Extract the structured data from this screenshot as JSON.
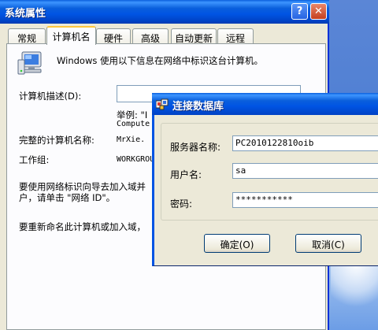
{
  "main_window": {
    "title": "系统属性",
    "help_glyph": "?",
    "close_glyph": "✕",
    "tabs": [
      {
        "label": "常规"
      },
      {
        "label": "计算机名"
      },
      {
        "label": "硬件"
      },
      {
        "label": "高级"
      },
      {
        "label": "自动更新"
      },
      {
        "label": "远程"
      }
    ],
    "active_tab": "计算机名",
    "intro_text": "Windows 使用以下信息在网络中标识这台计算机。",
    "description_label": "计算机描述(D):",
    "example_text": "举例: \"I",
    "example_text_2": "Compute",
    "full_name_label": "完整的计算机名称:",
    "full_name_value": "MrXie.",
    "workgroup_label": "工作组:",
    "workgroup_value": "WORKGROU",
    "network_id_text_1": "要使用网络标识向导去加入域并",
    "network_id_text_2": "户，请单击 \"网络 ID\"。",
    "rename_text": "要重新命名此计算机或加入域，"
  },
  "dialog": {
    "title": "连接数据库",
    "server_label": "服务器名称:",
    "server_value": "PC2010122810oib",
    "user_label": "用户名:",
    "user_value": "sa",
    "password_label": "密码:",
    "password_value": "***********",
    "ok_label": "确定(O)",
    "cancel_label": "取消(C)"
  },
  "colors": {
    "titlebar": "#0054e3",
    "window_face": "#ece9d8",
    "tab_highlight": "#ffc73c"
  },
  "icons": [
    "computer-icon",
    "app-icon",
    "help-icon",
    "close-icon"
  ]
}
